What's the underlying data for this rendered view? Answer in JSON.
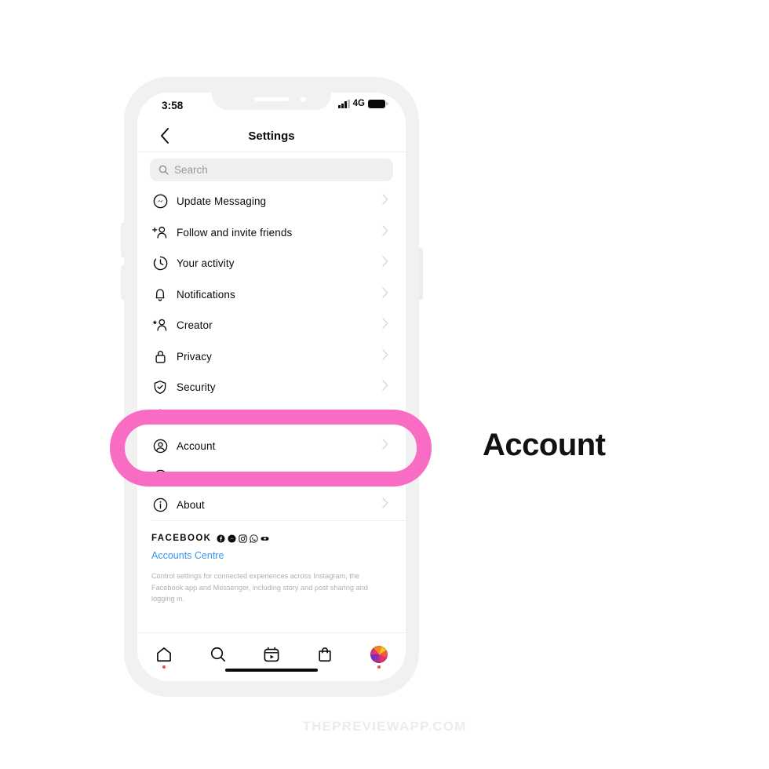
{
  "annotation": {
    "label": "Account",
    "highlight_color": "#f96cc3"
  },
  "watermark": {
    "text": "THEPREVIEWAPP.COM"
  },
  "phone": {
    "status_bar": {
      "time": "3:58",
      "network": "4G",
      "signal_icon": "signal-bars-icon",
      "battery_icon": "battery-icon"
    },
    "nav": {
      "back_icon": "chevron-left-icon",
      "title": "Settings"
    },
    "search": {
      "placeholder": "Search",
      "icon": "search-icon",
      "value": ""
    },
    "settings_items": [
      {
        "label": "Update Messaging",
        "icon": "messenger-icon",
        "chevron": "chevron-right-icon"
      },
      {
        "label": "Follow and invite friends",
        "icon": "person-plus-icon",
        "chevron": "chevron-right-icon"
      },
      {
        "label": "Your activity",
        "icon": "activity-clock-icon",
        "chevron": "chevron-right-icon"
      },
      {
        "label": "Notifications",
        "icon": "bell-icon",
        "chevron": "chevron-right-icon"
      },
      {
        "label": "Creator",
        "icon": "person-star-icon",
        "chevron": "chevron-right-icon"
      },
      {
        "label": "Privacy",
        "icon": "lock-icon",
        "chevron": "chevron-right-icon"
      },
      {
        "label": "Security",
        "icon": "shield-check-icon",
        "chevron": "chevron-right-icon"
      },
      {
        "label": "Account",
        "icon": "account-circle-icon",
        "chevron": "chevron-right-icon"
      }
    ],
    "about_item": {
      "label": "About",
      "icon": "info-circle-icon",
      "chevron": "chevron-right-icon"
    },
    "facebook_block": {
      "brand": "FACEBOOK",
      "brand_icons": [
        "facebook-icon",
        "messenger-icon",
        "instagram-icon",
        "whatsapp-icon",
        "oculus-icon"
      ],
      "link": "Accounts Centre",
      "description": "Control settings for connected experiences across Instagram, the Facebook app and Messenger, including story and post sharing and logging in.",
      "link_color": "#3897f0"
    },
    "tab_bar": [
      {
        "name": "home",
        "icon": "home-icon",
        "badge": true
      },
      {
        "name": "search",
        "icon": "search-icon",
        "badge": false
      },
      {
        "name": "reels",
        "icon": "reels-icon",
        "badge": false
      },
      {
        "name": "shop",
        "icon": "shop-bag-icon",
        "badge": false
      },
      {
        "name": "profile",
        "icon": "profile-avatar-icon",
        "badge": true
      }
    ]
  }
}
